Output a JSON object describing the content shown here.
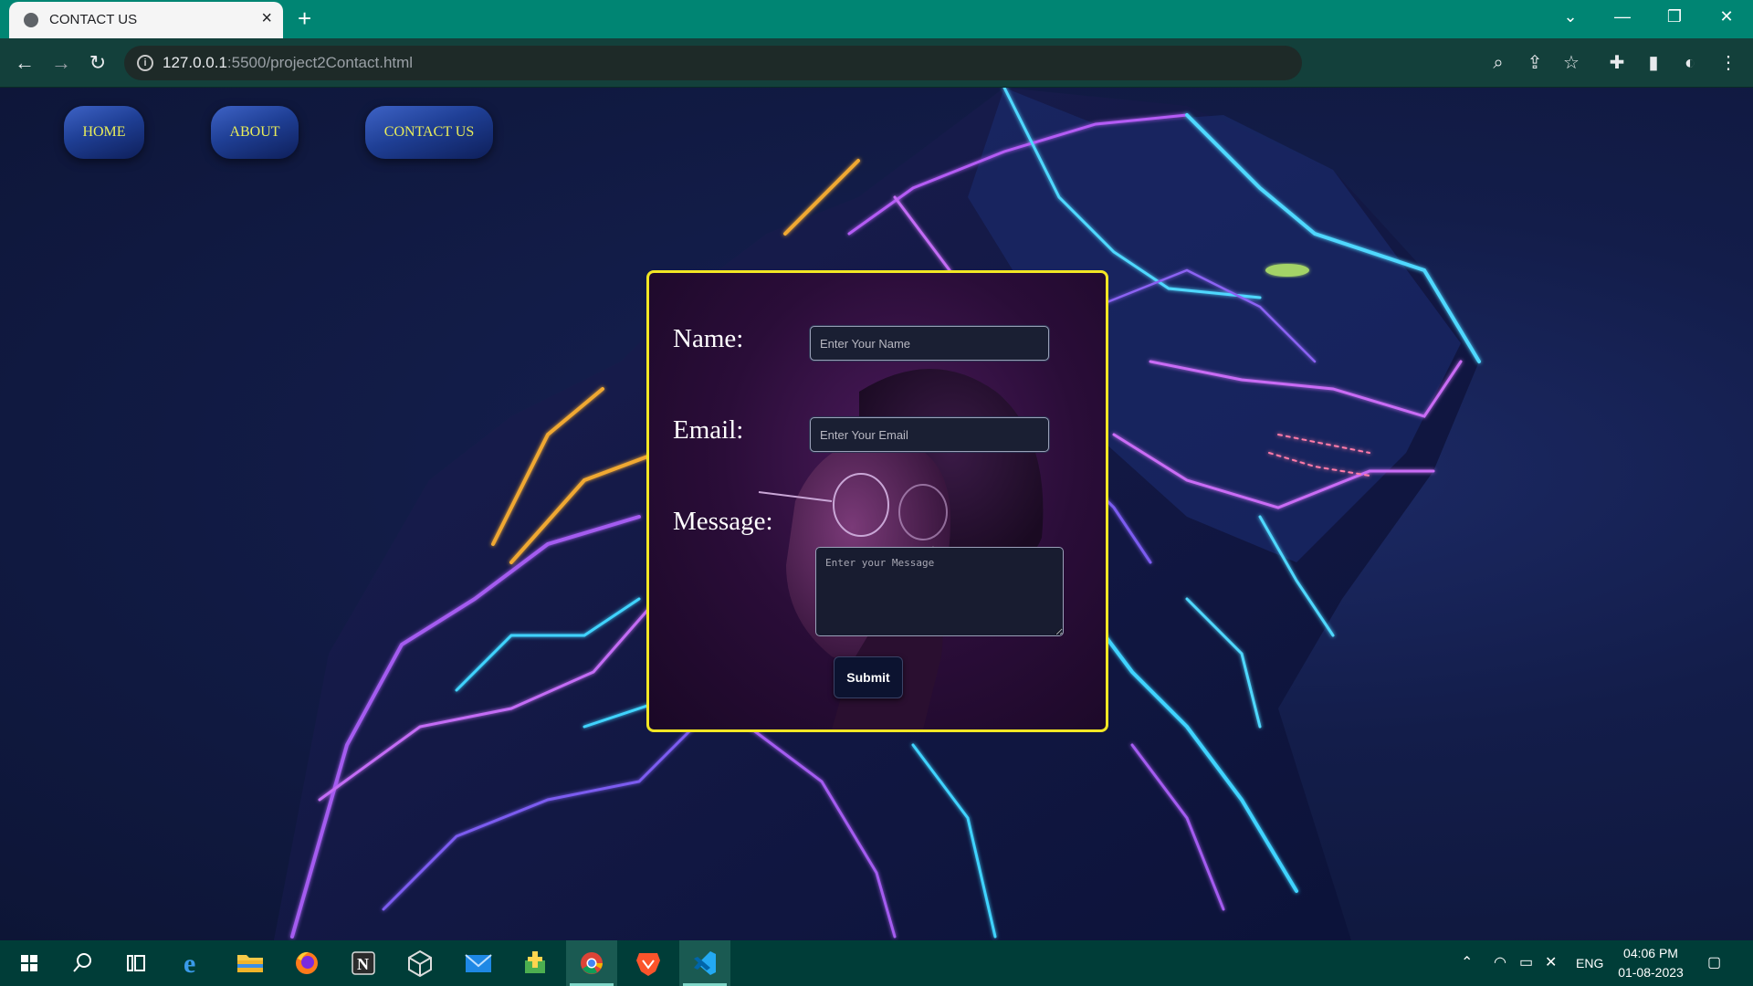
{
  "browser": {
    "tab_title": "CONTACT US",
    "url_host": "127.0.0.1",
    "url_rest": ":5500/project2Contact.html"
  },
  "nav": {
    "home": "HOME",
    "about": "ABOUT",
    "contact": "CONTACT US"
  },
  "form": {
    "name_label": "Name:",
    "name_placeholder": "Enter Your Name",
    "email_label": "Email:",
    "email_placeholder": "Enter Your Email",
    "message_label": "Message:",
    "message_placeholder": "Enter your Message",
    "submit_label": "Submit"
  },
  "taskbar": {
    "language": "ENG",
    "time": "04:06 PM",
    "date": "01-08-2023"
  },
  "colors": {
    "tabbar": "#008573",
    "accent_yellow": "#f2e624",
    "nav_text": "#e8ec5a"
  }
}
